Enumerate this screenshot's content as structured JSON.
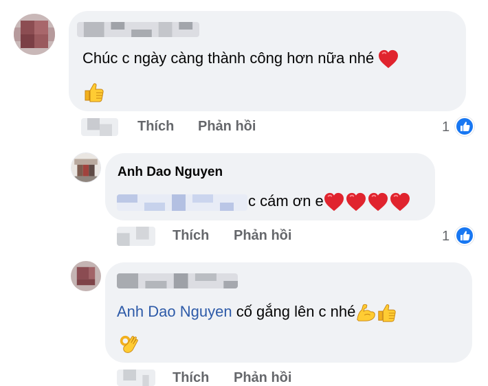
{
  "comments": [
    {
      "author": "",
      "text": "Chúc c ngày càng thành công hơn nữa nhé",
      "actions": {
        "like": "Thích",
        "reply": "Phản hồi"
      },
      "reaction_count": "1"
    },
    {
      "author": "Anh Dao Nguyen",
      "text": "c cám ơn e",
      "actions": {
        "like": "Thích",
        "reply": "Phản hồi"
      },
      "reaction_count": "1"
    },
    {
      "author": "",
      "mention": "Anh Dao Nguyen",
      "text": "cố gắng lên c nhé",
      "actions": {
        "like": "Thích",
        "reply": "Phản hồi"
      }
    }
  ],
  "colors": {
    "bubble": "#f0f2f5",
    "mention": "#2d5aa8",
    "like_blue": "#1877f2",
    "heart_red": "#e0242e",
    "action_gray": "#65676b"
  },
  "icons": [
    "red-heart-icon",
    "thumbs-up-emoji-icon",
    "flexed-biceps-emoji-icon",
    "ok-hand-emoji-icon",
    "like-badge-icon"
  ]
}
